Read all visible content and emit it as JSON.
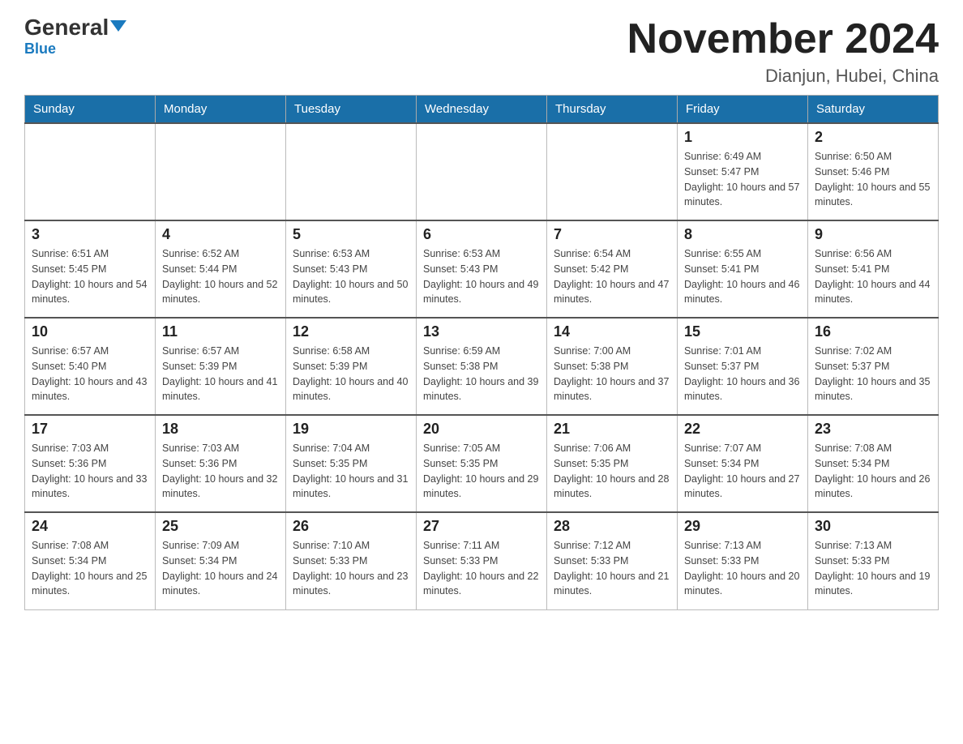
{
  "header": {
    "logo": {
      "text_general": "General",
      "text_blue": "Blue"
    },
    "title": "November 2024",
    "location": "Dianjun, Hubei, China"
  },
  "days_of_week": [
    "Sunday",
    "Monday",
    "Tuesday",
    "Wednesday",
    "Thursday",
    "Friday",
    "Saturday"
  ],
  "weeks": [
    [
      {
        "day": "",
        "info": ""
      },
      {
        "day": "",
        "info": ""
      },
      {
        "day": "",
        "info": ""
      },
      {
        "day": "",
        "info": ""
      },
      {
        "day": "",
        "info": ""
      },
      {
        "day": "1",
        "info": "Sunrise: 6:49 AM\nSunset: 5:47 PM\nDaylight: 10 hours and 57 minutes."
      },
      {
        "day": "2",
        "info": "Sunrise: 6:50 AM\nSunset: 5:46 PM\nDaylight: 10 hours and 55 minutes."
      }
    ],
    [
      {
        "day": "3",
        "info": "Sunrise: 6:51 AM\nSunset: 5:45 PM\nDaylight: 10 hours and 54 minutes."
      },
      {
        "day": "4",
        "info": "Sunrise: 6:52 AM\nSunset: 5:44 PM\nDaylight: 10 hours and 52 minutes."
      },
      {
        "day": "5",
        "info": "Sunrise: 6:53 AM\nSunset: 5:43 PM\nDaylight: 10 hours and 50 minutes."
      },
      {
        "day": "6",
        "info": "Sunrise: 6:53 AM\nSunset: 5:43 PM\nDaylight: 10 hours and 49 minutes."
      },
      {
        "day": "7",
        "info": "Sunrise: 6:54 AM\nSunset: 5:42 PM\nDaylight: 10 hours and 47 minutes."
      },
      {
        "day": "8",
        "info": "Sunrise: 6:55 AM\nSunset: 5:41 PM\nDaylight: 10 hours and 46 minutes."
      },
      {
        "day": "9",
        "info": "Sunrise: 6:56 AM\nSunset: 5:41 PM\nDaylight: 10 hours and 44 minutes."
      }
    ],
    [
      {
        "day": "10",
        "info": "Sunrise: 6:57 AM\nSunset: 5:40 PM\nDaylight: 10 hours and 43 minutes."
      },
      {
        "day": "11",
        "info": "Sunrise: 6:57 AM\nSunset: 5:39 PM\nDaylight: 10 hours and 41 minutes."
      },
      {
        "day": "12",
        "info": "Sunrise: 6:58 AM\nSunset: 5:39 PM\nDaylight: 10 hours and 40 minutes."
      },
      {
        "day": "13",
        "info": "Sunrise: 6:59 AM\nSunset: 5:38 PM\nDaylight: 10 hours and 39 minutes."
      },
      {
        "day": "14",
        "info": "Sunrise: 7:00 AM\nSunset: 5:38 PM\nDaylight: 10 hours and 37 minutes."
      },
      {
        "day": "15",
        "info": "Sunrise: 7:01 AM\nSunset: 5:37 PM\nDaylight: 10 hours and 36 minutes."
      },
      {
        "day": "16",
        "info": "Sunrise: 7:02 AM\nSunset: 5:37 PM\nDaylight: 10 hours and 35 minutes."
      }
    ],
    [
      {
        "day": "17",
        "info": "Sunrise: 7:03 AM\nSunset: 5:36 PM\nDaylight: 10 hours and 33 minutes."
      },
      {
        "day": "18",
        "info": "Sunrise: 7:03 AM\nSunset: 5:36 PM\nDaylight: 10 hours and 32 minutes."
      },
      {
        "day": "19",
        "info": "Sunrise: 7:04 AM\nSunset: 5:35 PM\nDaylight: 10 hours and 31 minutes."
      },
      {
        "day": "20",
        "info": "Sunrise: 7:05 AM\nSunset: 5:35 PM\nDaylight: 10 hours and 29 minutes."
      },
      {
        "day": "21",
        "info": "Sunrise: 7:06 AM\nSunset: 5:35 PM\nDaylight: 10 hours and 28 minutes."
      },
      {
        "day": "22",
        "info": "Sunrise: 7:07 AM\nSunset: 5:34 PM\nDaylight: 10 hours and 27 minutes."
      },
      {
        "day": "23",
        "info": "Sunrise: 7:08 AM\nSunset: 5:34 PM\nDaylight: 10 hours and 26 minutes."
      }
    ],
    [
      {
        "day": "24",
        "info": "Sunrise: 7:08 AM\nSunset: 5:34 PM\nDaylight: 10 hours and 25 minutes."
      },
      {
        "day": "25",
        "info": "Sunrise: 7:09 AM\nSunset: 5:34 PM\nDaylight: 10 hours and 24 minutes."
      },
      {
        "day": "26",
        "info": "Sunrise: 7:10 AM\nSunset: 5:33 PM\nDaylight: 10 hours and 23 minutes."
      },
      {
        "day": "27",
        "info": "Sunrise: 7:11 AM\nSunset: 5:33 PM\nDaylight: 10 hours and 22 minutes."
      },
      {
        "day": "28",
        "info": "Sunrise: 7:12 AM\nSunset: 5:33 PM\nDaylight: 10 hours and 21 minutes."
      },
      {
        "day": "29",
        "info": "Sunrise: 7:13 AM\nSunset: 5:33 PM\nDaylight: 10 hours and 20 minutes."
      },
      {
        "day": "30",
        "info": "Sunrise: 7:13 AM\nSunset: 5:33 PM\nDaylight: 10 hours and 19 minutes."
      }
    ]
  ]
}
